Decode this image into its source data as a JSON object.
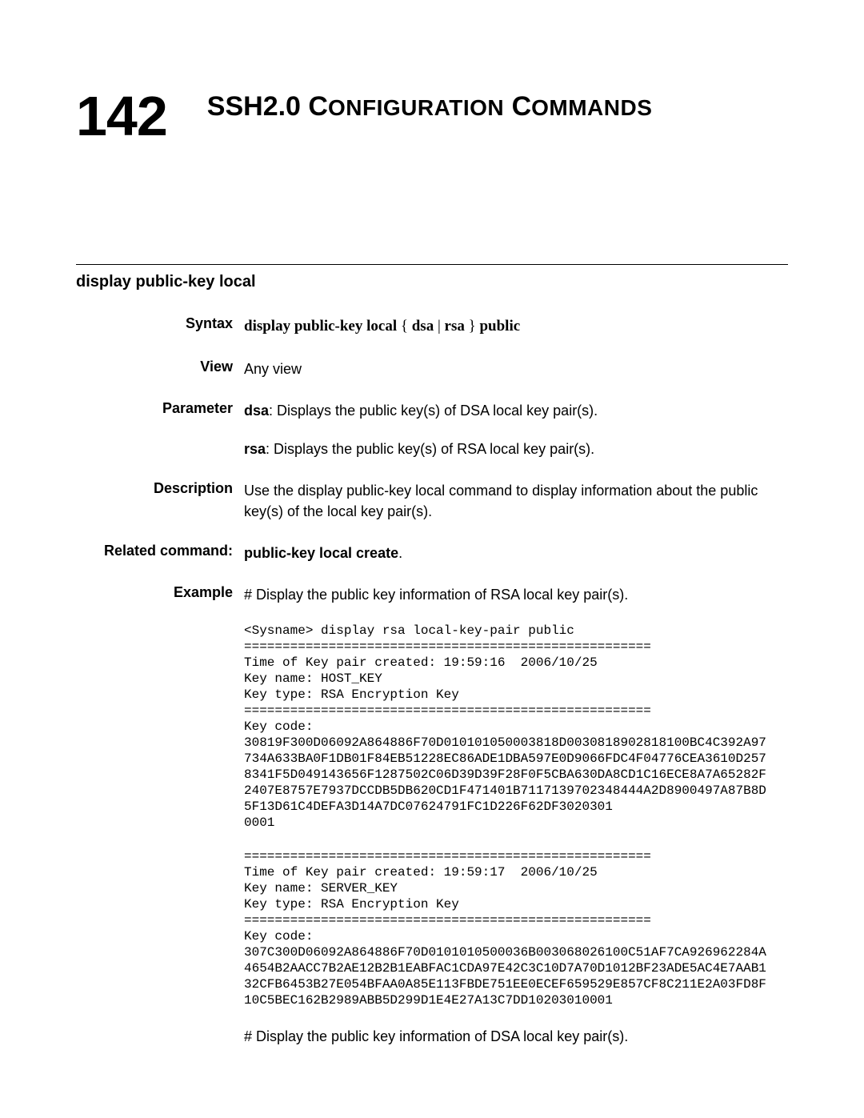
{
  "chapter": {
    "number": "142",
    "title_lead_1": "SSH2.0 C",
    "title_small_1": "ONFIGURATION",
    "title_lead_2": " C",
    "title_small_2": "OMMANDS"
  },
  "command_anchor": "display public-key local",
  "syntax": {
    "label": "Syntax",
    "kw1": "display public-key local",
    "brace_open": " { ",
    "kw2": "dsa",
    "pipe": " | ",
    "kw3": "rsa",
    "brace_close": " } ",
    "kw4": "public"
  },
  "view": {
    "label": "View",
    "text": "Any view"
  },
  "parameter": {
    "label": "Parameter",
    "dsa_key": "dsa",
    "dsa_text": ": Displays the public key(s) of DSA local key pair(s).",
    "rsa_key": "rsa",
    "rsa_text": ": Displays the public key(s) of RSA local key pair(s)."
  },
  "description": {
    "label": "Description",
    "text": "Use the display public-key local command to display information about the public key(s) of the local key pair(s)."
  },
  "related": {
    "label": "Related command:",
    "text": "public-key local create"
  },
  "example": {
    "label": "Example",
    "lead1": "# Display the public key information of RSA local key pair(s).",
    "cli1": "<Sysname> display rsa local-key-pair public\n=====================================================\nTime of Key pair created: 19:59:16  2006/10/25\nKey name: HOST_KEY\nKey type: RSA Encryption Key\n=====================================================\nKey code:\n30819F300D06092A864886F70D010101050003818D0030818902818100BC4C392A97\n734A633BA0F1DB01F84EB51228EC86ADE1DBA597E0D9066FDC4F04776CEA3610D257\n8341F5D049143656F1287502C06D39D39F28F0F5CBA630DA8CD1C16ECE8A7A65282F\n2407E8757E7937DCCDB5DB620CD1F471401B7117139702348444A2D8900497A87B8D\n5F13D61C4DEFA3D14A7DC07624791FC1D226F62DF3020301\n0001",
    "cli2": "=====================================================\nTime of Key pair created: 19:59:17  2006/10/25\nKey name: SERVER_KEY\nKey type: RSA Encryption Key\n=====================================================\nKey code:\n307C300D06092A864886F70D0101010500036B003068026100C51AF7CA926962284A\n4654B2AACC7B2AE12B2B1EABFAC1CDA97E42C3C10D7A70D1012BF23ADE5AC4E7AAB1\n32CFB6453B27E054BFAA0A85E113FBDE751EE0ECEF659529E857CF8C211E2A03FD8F\n10C5BEC162B2989ABB5D299D1E4E27A13C7DD10203010001",
    "lead2": "# Display the public key information of DSA local key pair(s)."
  }
}
